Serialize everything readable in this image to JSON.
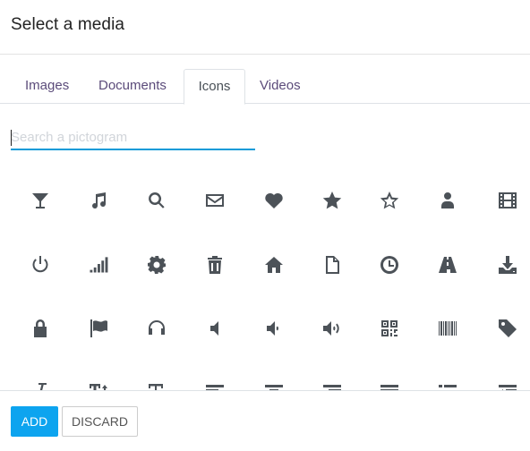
{
  "dialog": {
    "title": "Select a media"
  },
  "tabs": [
    {
      "label": "Images",
      "active": false
    },
    {
      "label": "Documents",
      "active": false
    },
    {
      "label": "Icons",
      "active": true
    },
    {
      "label": "Videos",
      "active": false
    }
  ],
  "search": {
    "placeholder": "Search a pictogram",
    "value": ""
  },
  "icons": [
    [
      "glass",
      "music",
      "search",
      "envelope",
      "heart",
      "star",
      "star-o",
      "user",
      "film"
    ],
    [
      "power-off",
      "signal",
      "cog",
      "trash",
      "home",
      "file-o",
      "clock",
      "road",
      "download"
    ],
    [
      "lock",
      "flag",
      "headphones",
      "volume-off",
      "volume-down",
      "volume-up",
      "qrcode",
      "barcode",
      "tag"
    ],
    [
      "italic",
      "text-height",
      "font",
      "align-left",
      "align-center",
      "align-right",
      "align-justify",
      "list",
      "outdent"
    ]
  ],
  "footer": {
    "add_label": "ADD",
    "discard_label": "DISCARD"
  },
  "colors": {
    "accent": "#0da4ef",
    "search_underline": "#0f9bd8",
    "tab_text": "#5b4b7a",
    "icon": "#4c5258"
  }
}
